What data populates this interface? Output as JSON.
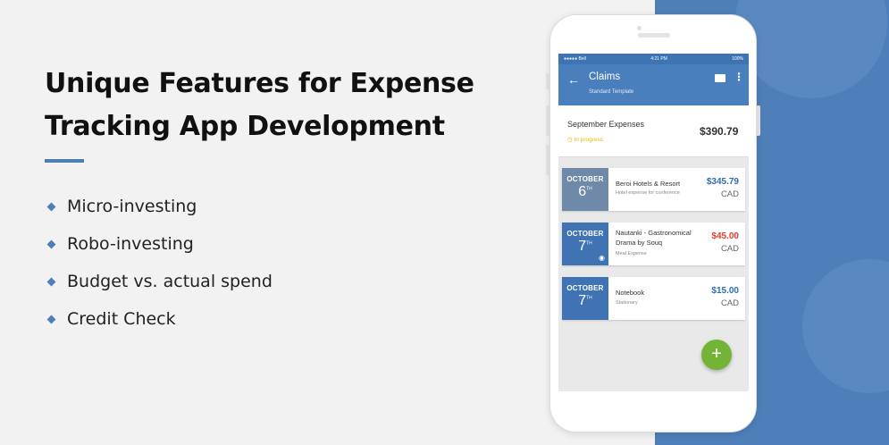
{
  "headline": {
    "line1": "Unique Features for Expense",
    "line2": "Tracking App Development"
  },
  "features": [
    "Micro-investing",
    "Robo-investing",
    "Budget vs. actual spend",
    "Credit Check"
  ],
  "phone": {
    "status_bar": {
      "carrier": "●●●●● Bell",
      "time": "4:21 PM",
      "battery": "100%"
    },
    "app_bar": {
      "title": "Claims",
      "subtitle": "Standard Template"
    },
    "summary": {
      "title": "September Expenses",
      "status": "In progress",
      "amount": "$390.79"
    },
    "claims": [
      {
        "month": "OCTOBER",
        "day": "6",
        "suffix": "TH",
        "title": "Beroi Hotels & Resort",
        "subtitle": "Hotel expense for conference",
        "amount": "$345.79",
        "currency": "CAD",
        "amount_color": "#2e6db0"
      },
      {
        "month": "OCTOBER",
        "day": "7",
        "suffix": "TH",
        "title": "Nautanki - Gastronomical Drama by Souq",
        "subtitle": "Meal Expense",
        "amount": "$45.00",
        "currency": "CAD",
        "amount_color": "#e33b2a"
      },
      {
        "month": "OCTOBER",
        "day": "7",
        "suffix": "TH",
        "title": "Notebook",
        "subtitle": "Stationary",
        "amount": "$15.00",
        "currency": "CAD",
        "amount_color": "#2e6db0"
      }
    ],
    "fab_label": "+"
  },
  "colors": {
    "brand_blue": "#4f7fb9",
    "fab_green": "#73b335",
    "status_yellow": "#e8b400"
  }
}
